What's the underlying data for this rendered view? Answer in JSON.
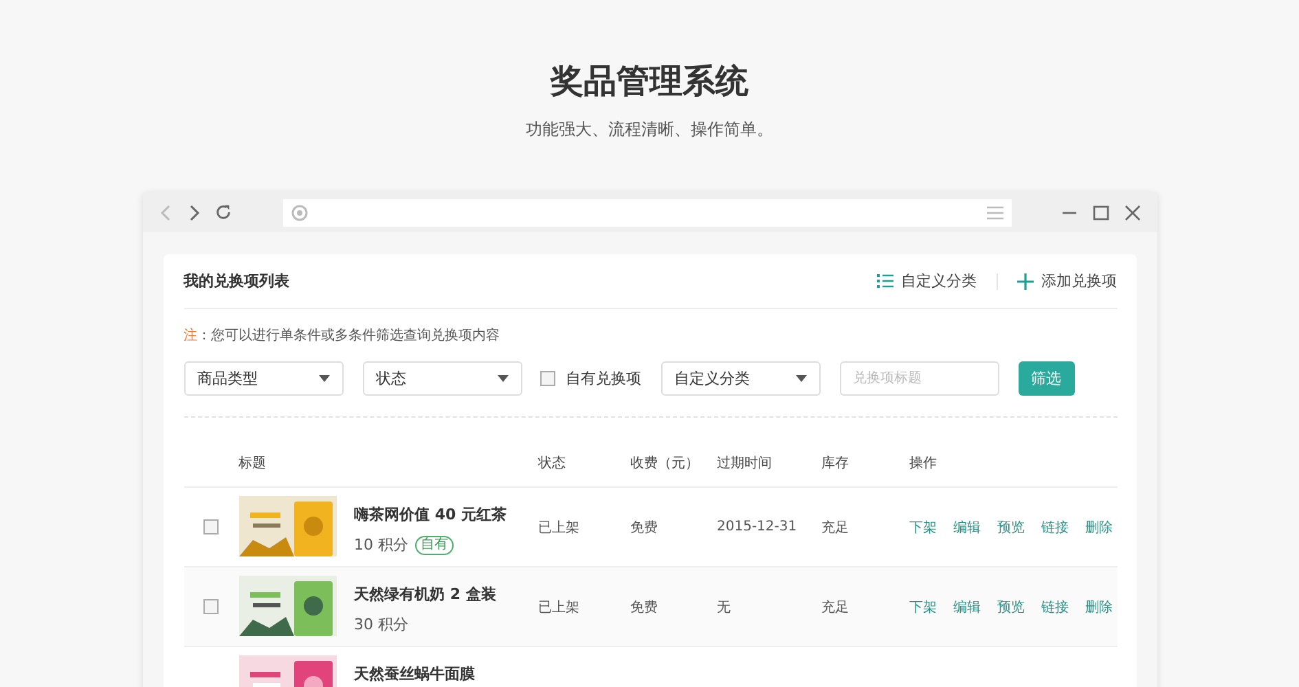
{
  "hero": {
    "title": "奖品管理系统",
    "subtitle": "功能强大、流程清晰、操作简单。"
  },
  "card": {
    "title": "我的兑换项列表",
    "actions": [
      {
        "kind": "list",
        "label": "自定义分类"
      },
      {
        "kind": "add",
        "label": "添加兑换项"
      }
    ]
  },
  "note": {
    "label": "注",
    "text": "：您可以进行单条件或多条件筛选查询兑换项内容"
  },
  "filters": [
    {
      "kind": "select",
      "label": "商品类型"
    },
    {
      "kind": "select",
      "label": "状态"
    },
    {
      "kind": "checkbox",
      "label": "自有兑换项",
      "checked": false
    },
    {
      "kind": "select",
      "label": "自定义分类"
    },
    {
      "kind": "input",
      "placeholder": "兑换项标题"
    },
    {
      "kind": "button",
      "label": "筛选"
    }
  ],
  "table": {
    "columns": [
      "标题",
      "状态",
      "收费（元）",
      "过期时间",
      "库存",
      "操作"
    ],
    "rows": [
      {
        "checked": false,
        "title": "嗨茶网价值 40 元红茶",
        "points": "10 积分",
        "badge": "自有",
        "status": "已上架",
        "fee": "免费",
        "expires": "2015-12-31",
        "stock": "充足",
        "ops": [
          "下架",
          "编辑",
          "预览",
          "链接",
          "删除"
        ]
      },
      {
        "checked": false,
        "title": "天然绿有机奶 2 盒装",
        "points": "30 积分",
        "status": "已上架",
        "fee": "免费",
        "expires": "无",
        "stock": "充足",
        "ops": [
          "下架",
          "编辑",
          "预览",
          "链接",
          "删除"
        ]
      },
      {
        "title": "天然蚕丝蜗牛面膜"
      }
    ]
  }
}
